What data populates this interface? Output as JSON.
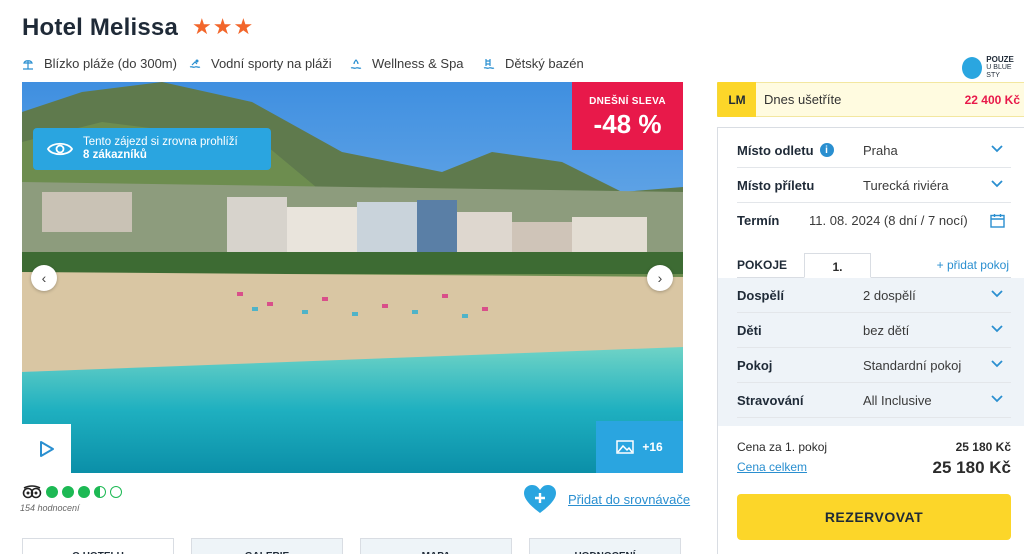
{
  "hotel": {
    "name": "Hotel Melissa",
    "stars": "★★★"
  },
  "amenities": [
    {
      "label": "Blízko pláže (do 300m)",
      "icon": "beach-icon"
    },
    {
      "label": "Vodní sporty na pláži",
      "icon": "swimmer-icon"
    },
    {
      "label": "Wellness & Spa",
      "icon": "spa-icon"
    },
    {
      "label": "Dětský bazén",
      "icon": "kids-pool-icon"
    }
  ],
  "exclusive": {
    "line1": "POUZE",
    "line2": "U BLUE STY"
  },
  "photo": {
    "discount_label": "DNEŠNÍ SLEVA",
    "discount_value": "-48 %",
    "viewers_text": "Tento zájezd si zrovna prohlíží",
    "viewers_count": "8 zákazníků",
    "more_photos": "+16"
  },
  "rating": {
    "tripadvisor_score": 3.5,
    "reviews": "154 hodnocení"
  },
  "compare": {
    "label": "Přidat do srovnávače"
  },
  "tabs": [
    "O HOTELU",
    "GALERIE",
    "MAPA",
    "HODNOCENÍ"
  ],
  "lastminute": {
    "badge": "LM",
    "text": "Dnes ušetříte",
    "amount": "22 400 Kč"
  },
  "booking": {
    "departure_label": "Místo odletu",
    "departure_value": "Praha",
    "arrival_label": "Místo příletu",
    "arrival_value": "Turecká riviéra",
    "term_label": "Termín",
    "term_value": "11. 08. 2024 (8 dní / 7 nocí)",
    "rooms_label": "POKOJE",
    "room_tab": "1.",
    "add_room": "+ přidat pokoj",
    "adults_label": "Dospělí",
    "adults_value": "2 dospělí",
    "children_label": "Děti",
    "children_value": "bez dětí",
    "room_label": "Pokoj",
    "room_value": "Standardní pokoj",
    "board_label": "Stravování",
    "board_value": "All Inclusive",
    "price_room_label": "Cena za 1. pokoj",
    "price_room_value": "25 180 Kč",
    "price_total_label": "Cena celkem",
    "price_total_value": "25 180 Kč",
    "reserve_label": "REZERVOVAT"
  },
  "colors": {
    "accent": "#2aa5e0",
    "sale": "#e8194a",
    "cta": "#fcd629",
    "stars": "#f2662b"
  }
}
